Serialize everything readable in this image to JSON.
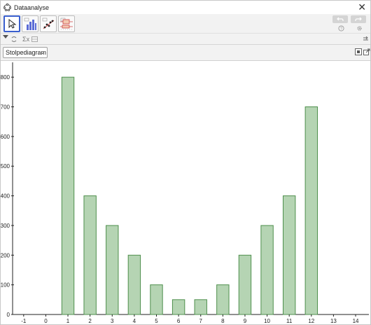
{
  "window": {
    "title": "Dataanalyse",
    "close_glyph": "✕"
  },
  "toolbar": {
    "tools": [
      {
        "name": "move-tool",
        "icon": "arrow-cursor-icon",
        "selected": true
      },
      {
        "name": "histogram-tool",
        "icon": "bar-chart-icon",
        "selected": false
      },
      {
        "name": "scatter-tool",
        "icon": "scatter-plot-icon",
        "selected": false
      },
      {
        "name": "boxplot-tool",
        "icon": "boxplot-icon",
        "selected": false
      }
    ],
    "undo_icon": "undo-icon",
    "redo_icon": "redo-icon",
    "help_icon": "help-icon",
    "settings_icon": "gear-icon"
  },
  "toolbar2": {
    "sigma_label": "Σx",
    "stats_icon": "table-icon"
  },
  "view": {
    "chart_type_selected": "Stolpediagram",
    "icons": [
      "fit-view-icon",
      "export-icon"
    ]
  },
  "colors": {
    "bar_fill": "#b5d4b3",
    "bar_stroke": "#4e8f4c",
    "selected_tool_border": "#3a5fcd"
  },
  "chart_data": {
    "type": "bar",
    "categories": [
      1,
      2,
      3,
      4,
      5,
      6,
      7,
      8,
      9,
      10,
      11,
      12
    ],
    "values": [
      800,
      400,
      300,
      200,
      100,
      50,
      50,
      100,
      200,
      300,
      400,
      700
    ],
    "x_ticks": [
      "-1",
      "0",
      "1",
      "2",
      "3",
      "4",
      "5",
      "6",
      "7",
      "8",
      "9",
      "10",
      "11",
      "12",
      "13",
      "14"
    ],
    "y_ticks": [
      "0",
      "100",
      "200",
      "300",
      "400",
      "500",
      "600",
      "700",
      "800"
    ],
    "xlim": [
      -1.5,
      14.6
    ],
    "ylim": [
      0,
      850
    ],
    "grid": false,
    "title": "",
    "xlabel": "",
    "ylabel": ""
  }
}
